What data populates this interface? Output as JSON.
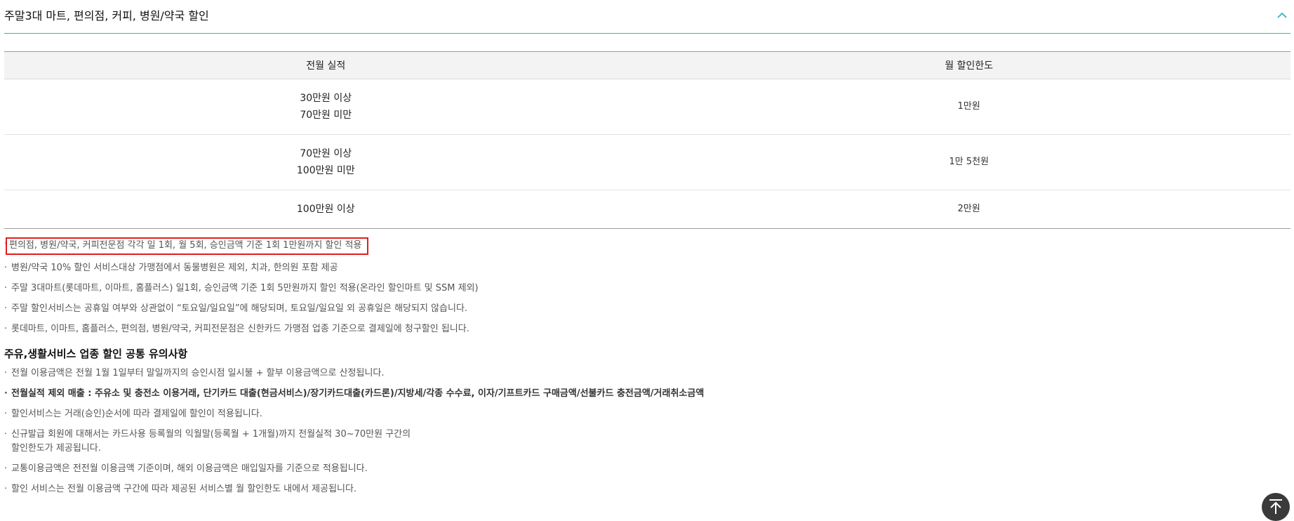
{
  "section": {
    "title": "주말3대 마트, 편의점, 커피, 병원/약국 할인",
    "toggle_icon": "chevron-up-icon",
    "accent_color": "#2eb3c2"
  },
  "table": {
    "headers": [
      "전월 실적",
      "월 할인한도"
    ],
    "rows": [
      {
        "performance_line1": "30만원 이상",
        "performance_line2": "70만원 미만",
        "limit": "1만원"
      },
      {
        "performance_line1": "70만원 이상",
        "performance_line2": "100만원 미만",
        "limit": "1만 5천원"
      },
      {
        "performance_line1": "100만원 이상",
        "performance_line2": "",
        "limit": "2만원"
      }
    ]
  },
  "notes": [
    "편의점, 병원/약국, 커피전문점 각각 일 1회, 월 5회, 승인금액 기준 1회 1만원까지 할인 적용",
    "병원/약국 10% 할인 서비스대상 가맹점에서 동물병원은 제외, 치과, 한의원 포함 제공",
    "주말 3대마트(롯데마트, 이마트, 홈플러스) 일1회, 승인금액 기준 1회 5만원까지 할인 적용(온라인 할인마트 및 SSM 제외)",
    "주말 할인서비스는 공휴일 여부와 상관없이 “토요일/일요일”에 해당되며, 토요일/일요일 외 공휴일은 해당되지 않습니다.",
    "롯데마트, 이마트, 홈플러스, 편의점, 병원/약국, 커피전문점은 신한카드 가맹점 업종 기준으로 결제일에 청구할인 됩니다."
  ],
  "common": {
    "title": "주유,생활서비스 업종 할인 공통 유의사항",
    "notes": [
      "전월 이용금액은 전월 1월 1일부터 말일까지의 승인시점 일시불 + 할부 이용금액으로 산정됩니다.",
      "전월실적 제외 매출 : 주유소 및 충전소 이용거래, 단기카드 대출(현금서비스)/장기카드대출(카드론)/지방세/각종 수수료, 이자/기프트카드 구매금액/선불카드 충전금액/거래취소금액",
      "할인서비스는 거래(승인)순서에 따라 결제일에 할인이 적용됩니다.",
      "신규발급 회원에 대해서는 카드사용 등록월의 익월말(등록월 + 1개월)까지 전월실적 30~70만원 구간의",
      "할인한도가 제공됩니다.",
      "교통이용금액은 전전월 이용금액 기준이며, 해외 이용금액은 매입일자를 기준으로 적용됩니다.",
      "할인 서비스는 전월 이용금액 구간에 따라 제공된 서비스별 월 할인한도 내에서 제공됩니다."
    ]
  },
  "highlight_color": "#e41d1d",
  "top_button": {
    "icon": "arrow-up-icon"
  }
}
